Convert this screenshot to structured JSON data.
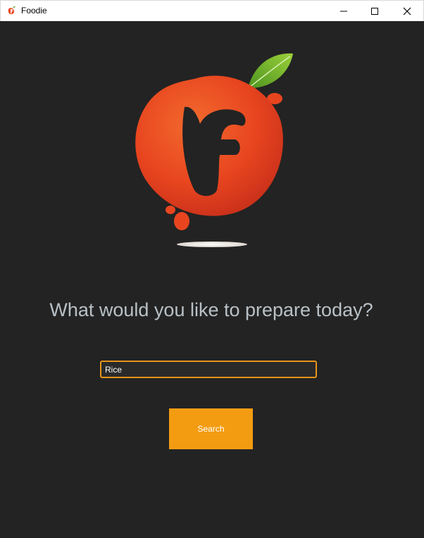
{
  "window": {
    "title": "Foodie",
    "icon": "foodie-app-icon"
  },
  "controls": {
    "minimize_icon": "minimize-icon",
    "maximize_icon": "maximize-icon",
    "close_icon": "close-icon"
  },
  "logo": {
    "icon": "foodie-logo",
    "colors": {
      "fruit": "#e8451f",
      "leaf": "#6aac2a"
    }
  },
  "main": {
    "prompt": "What would you like to prepare today?",
    "search": {
      "value": "Rice",
      "placeholder": ""
    },
    "search_button_label": "Search"
  },
  "colors": {
    "background": "#232323",
    "accent": "#f39c12",
    "input_border": "#e8941a",
    "prompt_text": "#b9c1c6"
  }
}
